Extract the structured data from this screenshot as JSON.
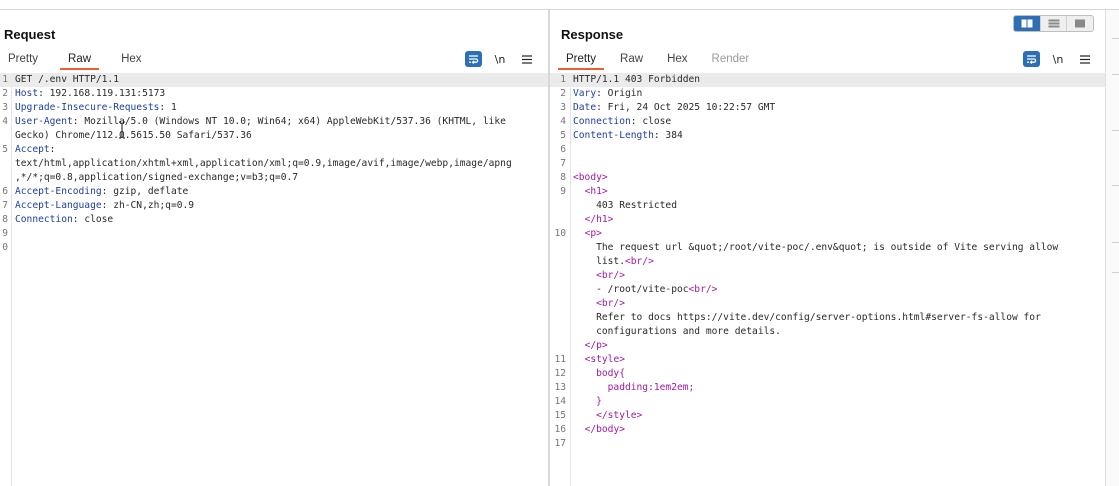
{
  "request": {
    "title": "Request",
    "tabs": [
      "Pretty",
      "Raw",
      "Hex"
    ],
    "active_tab": "Raw",
    "newline_label": "\\n",
    "lines": [
      {
        "n": "1",
        "parts": [
          {
            "t": "GET /.env HTTP/1.1",
            "c": "plain"
          }
        ],
        "hl": true
      },
      {
        "n": "2",
        "parts": [
          {
            "t": "Host",
            "c": "key"
          },
          {
            "t": ": 192.168.119.131:5173",
            "c": "plain"
          }
        ]
      },
      {
        "n": "3",
        "parts": [
          {
            "t": "Upgrade-Insecure-Requests",
            "c": "key"
          },
          {
            "t": ": 1",
            "c": "plain"
          }
        ]
      },
      {
        "n": "4",
        "parts": [
          {
            "t": "User-Agent",
            "c": "key"
          },
          {
            "t": ": Mozilla/5.0 (Windows NT 10.0; Win64; x64) AppleWebKit/537.36 (KHTML, like",
            "c": "plain"
          }
        ]
      },
      {
        "n": "",
        "parts": [
          {
            "t": "Gecko) Chrome/112.0.5615.50 Safari/537.36",
            "c": "plain"
          }
        ]
      },
      {
        "n": "5",
        "parts": [
          {
            "t": "Accept",
            "c": "key"
          },
          {
            "t": ":",
            "c": "plain"
          }
        ]
      },
      {
        "n": "",
        "parts": [
          {
            "t": "text/html,application/xhtml+xml,application/xml;q=0.9,image/avif,image/webp,image/apng",
            "c": "plain"
          }
        ]
      },
      {
        "n": "",
        "parts": [
          {
            "t": ",*/*;q=0.8,application/signed-exchange;v=b3;q=0.7",
            "c": "plain"
          }
        ]
      },
      {
        "n": "6",
        "parts": [
          {
            "t": "Accept-Encoding",
            "c": "key"
          },
          {
            "t": ": gzip, deflate",
            "c": "plain"
          }
        ]
      },
      {
        "n": "7",
        "parts": [
          {
            "t": "Accept-Language",
            "c": "key"
          },
          {
            "t": ": zh-CN,zh;q=0.9",
            "c": "plain"
          }
        ]
      },
      {
        "n": "8",
        "parts": [
          {
            "t": "Connection",
            "c": "key"
          },
          {
            "t": ": close",
            "c": "plain"
          }
        ]
      },
      {
        "n": "9",
        "parts": []
      },
      {
        "n": "0",
        "parts": []
      }
    ]
  },
  "response": {
    "title": "Response",
    "tabs": [
      "Pretty",
      "Raw",
      "Hex",
      "Render"
    ],
    "active_tab": "Pretty",
    "newline_label": "\\n",
    "lines": [
      {
        "n": "1",
        "parts": [
          {
            "t": "HTTP/1.1 403 Forbidden",
            "c": "plain"
          }
        ],
        "hl": true
      },
      {
        "n": "2",
        "parts": [
          {
            "t": "Vary",
            "c": "key"
          },
          {
            "t": ": Origin",
            "c": "plain"
          }
        ]
      },
      {
        "n": "3",
        "parts": [
          {
            "t": "Date",
            "c": "key"
          },
          {
            "t": ": Fri, 24 Oct 2025 10:22:57 GMT",
            "c": "plain"
          }
        ]
      },
      {
        "n": "4",
        "parts": [
          {
            "t": "Connection",
            "c": "key"
          },
          {
            "t": ": close",
            "c": "plain"
          }
        ]
      },
      {
        "n": "5",
        "parts": [
          {
            "t": "Content-Length",
            "c": "key"
          },
          {
            "t": ": 384",
            "c": "plain"
          }
        ]
      },
      {
        "n": "6",
        "parts": []
      },
      {
        "n": "7",
        "parts": []
      },
      {
        "n": "8",
        "parts": [
          {
            "t": "<body>",
            "c": "tag"
          }
        ]
      },
      {
        "n": "9",
        "parts": [
          {
            "t": "  ",
            "c": "plain"
          },
          {
            "t": "<h1>",
            "c": "tag"
          }
        ]
      },
      {
        "n": "",
        "parts": [
          {
            "t": "    403 Restricted",
            "c": "plain"
          }
        ]
      },
      {
        "n": "",
        "parts": [
          {
            "t": "  ",
            "c": "plain"
          },
          {
            "t": "</h1>",
            "c": "tag"
          }
        ]
      },
      {
        "n": "10",
        "parts": [
          {
            "t": "  ",
            "c": "plain"
          },
          {
            "t": "<p>",
            "c": "tag"
          }
        ]
      },
      {
        "n": "",
        "parts": [
          {
            "t": "    The request url &quot;/root/vite-poc/.env&quot; is outside of Vite serving allow",
            "c": "plain"
          }
        ]
      },
      {
        "n": "",
        "parts": [
          {
            "t": "    list.",
            "c": "plain"
          },
          {
            "t": "<br/>",
            "c": "tag"
          }
        ]
      },
      {
        "n": "",
        "parts": [
          {
            "t": "    ",
            "c": "plain"
          },
          {
            "t": "<br/>",
            "c": "tag"
          }
        ]
      },
      {
        "n": "",
        "parts": [
          {
            "t": "    - /root/vite-poc",
            "c": "plain"
          },
          {
            "t": "<br/>",
            "c": "tag"
          }
        ]
      },
      {
        "n": "",
        "parts": [
          {
            "t": "    ",
            "c": "plain"
          },
          {
            "t": "<br/>",
            "c": "tag"
          }
        ]
      },
      {
        "n": "",
        "parts": [
          {
            "t": "    Refer to docs https://vite.dev/config/server-options.html#server-fs-allow for",
            "c": "plain"
          }
        ]
      },
      {
        "n": "",
        "parts": [
          {
            "t": "    configurations and more details.",
            "c": "plain"
          }
        ]
      },
      {
        "n": "",
        "parts": [
          {
            "t": "  ",
            "c": "plain"
          },
          {
            "t": "</p>",
            "c": "tag"
          }
        ]
      },
      {
        "n": "11",
        "parts": [
          {
            "t": "  ",
            "c": "plain"
          },
          {
            "t": "<style>",
            "c": "tag"
          }
        ]
      },
      {
        "n": "12",
        "parts": [
          {
            "t": "    ",
            "c": "plain"
          },
          {
            "t": "body{",
            "c": "tag"
          }
        ]
      },
      {
        "n": "13",
        "parts": [
          {
            "t": "      ",
            "c": "plain"
          },
          {
            "t": "padding:1em2em;",
            "c": "tag"
          }
        ]
      },
      {
        "n": "14",
        "parts": [
          {
            "t": "    ",
            "c": "plain"
          },
          {
            "t": "}",
            "c": "tag"
          }
        ]
      },
      {
        "n": "15",
        "parts": [
          {
            "t": "    ",
            "c": "plain"
          },
          {
            "t": "</style>",
            "c": "tag"
          }
        ]
      },
      {
        "n": "16",
        "parts": [
          {
            "t": "  ",
            "c": "plain"
          },
          {
            "t": "</body>",
            "c": "tag"
          }
        ]
      },
      {
        "n": "17",
        "parts": []
      }
    ]
  },
  "layout_switch": {
    "options": [
      "side-by-side-icon",
      "stacked-rows-icon",
      "single-pane-icon"
    ],
    "active": "side-by-side-icon"
  },
  "colors": {
    "accent_tab_underline": "#e8602c",
    "header_key": "#1f3fa0",
    "html_tag": "#a01aa0",
    "active_button": "#2c6fb5"
  }
}
